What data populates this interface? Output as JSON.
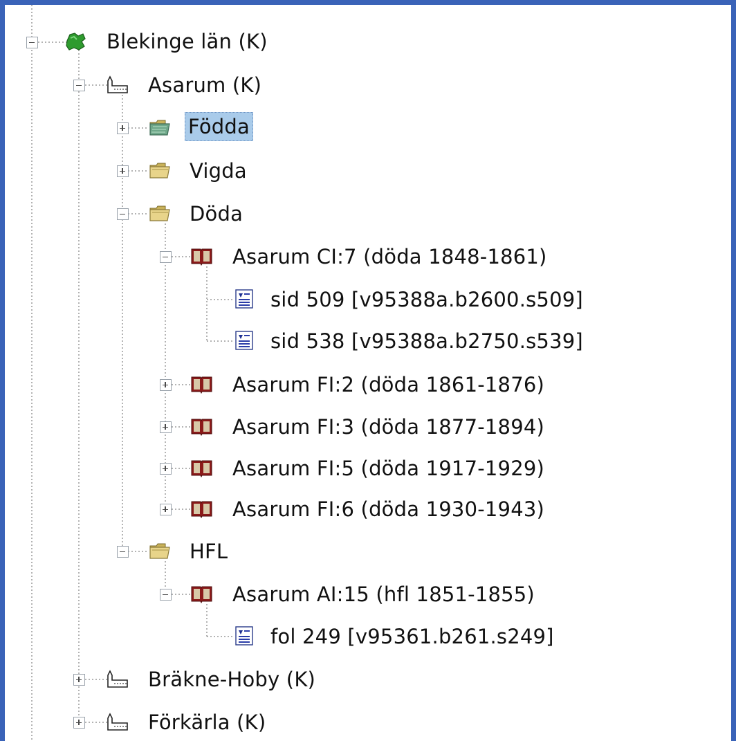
{
  "tree": {
    "county": {
      "label": "Blekinge län (K)",
      "icon": "county-green-icon"
    },
    "parish_asarum": {
      "label": "Asarum (K)",
      "icon": "church-icon"
    },
    "fodda": {
      "label": "Födda",
      "icon": "folder-open-icon",
      "selected": true
    },
    "vigda": {
      "label": "Vigda",
      "icon": "folder-icon"
    },
    "doda": {
      "label": "Döda",
      "icon": "folder-icon"
    },
    "book_cl7": {
      "label": "Asarum CI:7 (döda 1848-1861)",
      "icon": "book-icon"
    },
    "page_509": {
      "label": "sid 509 [v95388a.b2600.s509]",
      "icon": "page-icon"
    },
    "page_538": {
      "label": "sid 538 [v95388a.b2750.s539]",
      "icon": "page-icon"
    },
    "book_f2": {
      "label": "Asarum FI:2 (döda 1861-1876)",
      "icon": "book-icon"
    },
    "book_f3": {
      "label": "Asarum FI:3 (döda 1877-1894)",
      "icon": "book-icon"
    },
    "book_f5": {
      "label": "Asarum FI:5 (döda 1917-1929)",
      "icon": "book-icon"
    },
    "book_f6": {
      "label": "Asarum FI:6 (döda 1930-1943)",
      "icon": "book-icon"
    },
    "hfl": {
      "label": "HFL",
      "icon": "folder-icon"
    },
    "book_ai15": {
      "label": "Asarum AI:15 (hfl 1851-1855)",
      "icon": "book-icon"
    },
    "fol_249": {
      "label": "fol 249 [v95361.b261.s249]",
      "icon": "page-icon"
    },
    "parish_brakne": {
      "label": "Bräkne-Hoby (K)",
      "icon": "church-icon"
    },
    "parish_forkarla": {
      "label": "Förkärla (K)",
      "icon": "church-icon"
    }
  },
  "colors": {
    "frame_border": "#3a63b8",
    "selection": "#a9cbea",
    "book": "#8b1a1a",
    "county_green": "#2e9b2e",
    "folder": "#e8d48a"
  }
}
